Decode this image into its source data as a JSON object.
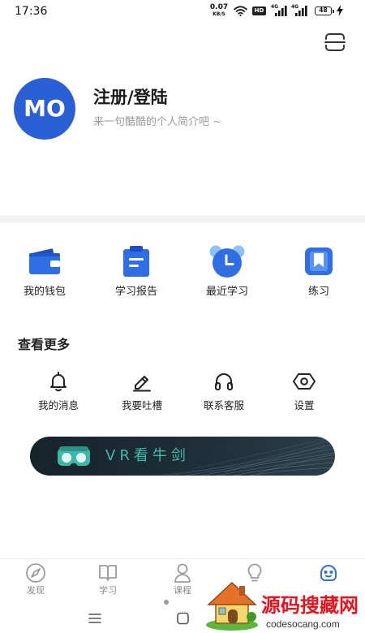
{
  "status_bar": {
    "time": "17:36",
    "net_speed_value": "0.07",
    "net_speed_unit": "KB/S",
    "hd_badge": "HD",
    "signal_1_label": "4G",
    "signal_2_label": "4G",
    "battery_level": "48",
    "icons": [
      "wifi-icon",
      "signal-bars-icon",
      "battery-icon",
      "charging-icon"
    ]
  },
  "header": {
    "action_icon": "scan-icon"
  },
  "profile": {
    "avatar_text": "MO",
    "title": "注册/登陆",
    "subtitle": "来一句酷酷的个人简介吧 ~"
  },
  "quick_actions": [
    {
      "label": "我的钱包",
      "icon": "wallet-icon"
    },
    {
      "label": "学习报告",
      "icon": "report-icon"
    },
    {
      "label": "最近学习",
      "icon": "alarm-clock-icon"
    },
    {
      "label": "练习",
      "icon": "bookmark-icon"
    }
  ],
  "more": {
    "title": "查看更多",
    "items": [
      {
        "label": "我的消息",
        "icon": "bell-icon"
      },
      {
        "label": "我要吐槽",
        "icon": "pencil-icon"
      },
      {
        "label": "联系客服",
        "icon": "headphones-icon"
      },
      {
        "label": "设置",
        "icon": "settings-icon"
      }
    ]
  },
  "banner": {
    "text": "VR看牛剑",
    "icon": "vr-goggles-icon"
  },
  "tab_bar": {
    "active_index": 4,
    "items": [
      {
        "label": "发现",
        "icon": "compass-icon"
      },
      {
        "label": "学习",
        "icon": "book-icon"
      },
      {
        "label": "课程",
        "icon": "course-icon"
      },
      {
        "icon": "lightbulb-icon"
      },
      {
        "icon": "smiley-icon"
      }
    ]
  },
  "system_nav": {
    "icons": [
      "menu-icon",
      "home-icon"
    ]
  },
  "watermark": {
    "title": "源码搜藏网",
    "url": "codesocang.com",
    "icon": "house-icon"
  },
  "colors": {
    "primary": "#2f6ee3",
    "avatar_background": "#2a5fd6",
    "banner_text": "#3fb9ad",
    "banner_background": "#1c2a33",
    "tab_inactive": "#9b9b9b",
    "watermark_text": "#e3141e"
  }
}
